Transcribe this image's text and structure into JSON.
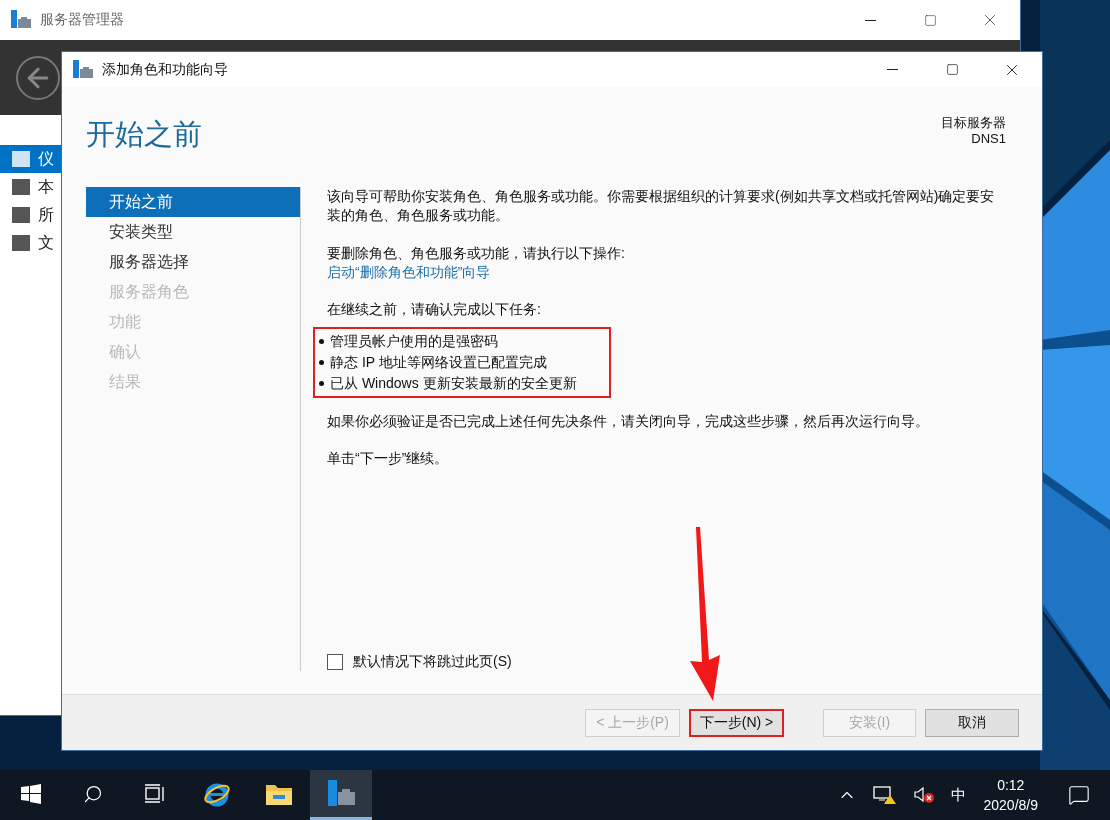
{
  "server_manager": {
    "title": "服务器管理器",
    "nav_items": [
      {
        "label": "仪",
        "selected": true
      },
      {
        "label": "本",
        "selected": false
      },
      {
        "label": "所",
        "selected": false
      },
      {
        "label": "文",
        "selected": false
      }
    ]
  },
  "wizard": {
    "title": "添加角色和功能向导",
    "heading": "开始之前",
    "target_label": "目标服务器",
    "target_server": "DNS1",
    "steps": [
      {
        "label": "开始之前",
        "selected": true,
        "disabled": false
      },
      {
        "label": "安装类型",
        "selected": false,
        "disabled": false
      },
      {
        "label": "服务器选择",
        "selected": false,
        "disabled": false
      },
      {
        "label": "服务器角色",
        "selected": false,
        "disabled": true
      },
      {
        "label": "功能",
        "selected": false,
        "disabled": true
      },
      {
        "label": "确认",
        "selected": false,
        "disabled": true
      },
      {
        "label": "结果",
        "selected": false,
        "disabled": true
      }
    ],
    "intro": "该向导可帮助你安装角色、角色服务或功能。你需要根据组织的计算要求(例如共享文档或托管网站)确定要安装的角色、角色服务或功能。",
    "remove_prompt": "要删除角色、角色服务或功能，请执行以下操作:",
    "remove_link": "启动“删除角色和功能”向导",
    "confirm_prompt": "在继续之前，请确认完成以下任务:",
    "tasks_highlighted": true,
    "tasks": [
      "管理员帐户使用的是强密码",
      "静态 IP 地址等网络设置已配置完成",
      "已从 Windows 更新安装最新的安全更新"
    ],
    "note": "如果你必须验证是否已完成上述任何先决条件，请关闭向导，完成这些步骤，然后再次运行向导。",
    "continue_hint": "单击“下一步”继续。",
    "skip_checkbox": {
      "label": "默认情况下将跳过此页(S)",
      "checked": false
    },
    "buttons": [
      {
        "label": "< 上一步(P)",
        "disabled": true,
        "highlighted": false
      },
      {
        "label": "下一步(N) >",
        "disabled": false,
        "highlighted": true
      },
      {
        "label": "安装(I)",
        "disabled": true,
        "highlighted": false
      },
      {
        "label": "取消",
        "disabled": false,
        "highlighted": false
      }
    ],
    "pointer_arrow": true
  },
  "taskbar": {
    "apps": [
      {
        "kind": "ie",
        "active": false
      },
      {
        "kind": "explorer",
        "active": false
      },
      {
        "kind": "server-manager",
        "active": true
      }
    ],
    "ime": "中",
    "time": "0:12",
    "date": "2020/8/9"
  }
}
